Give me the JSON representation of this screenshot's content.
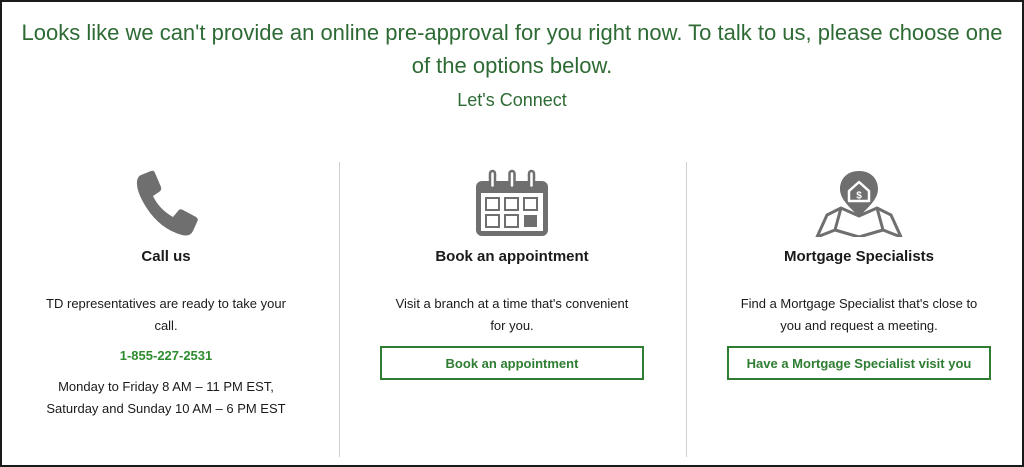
{
  "header": {
    "message": "Looks like we can't provide an online pre-approval for you right now. To talk to us, please choose one of the options below.",
    "subtitle": "Let's Connect"
  },
  "options": {
    "call": {
      "icon": "phone-icon",
      "title": "Call us",
      "description": "TD representatives are ready to take your call.",
      "phone": "1-855-227-2531",
      "hours_line1": "Monday to Friday 8 AM – 11 PM EST,",
      "hours_line2": "Saturday and Sunday 10 AM – 6 PM EST"
    },
    "appointment": {
      "icon": "calendar-icon",
      "title": "Book an appointment",
      "description": "Visit a branch at a time that's convenient for you.",
      "button_label": "Book an appointment"
    },
    "specialist": {
      "icon": "map-pin-house-icon",
      "title": "Mortgage Specialists",
      "description": "Find a Mortgage Specialist that's close to you and request a meeting.",
      "button_label": "Have a Mortgage Specialist visit you"
    }
  },
  "colors": {
    "brand_green": "#2e7d32",
    "heading_green": "#2e6b34",
    "icon_gray": "#6f6f6f"
  }
}
